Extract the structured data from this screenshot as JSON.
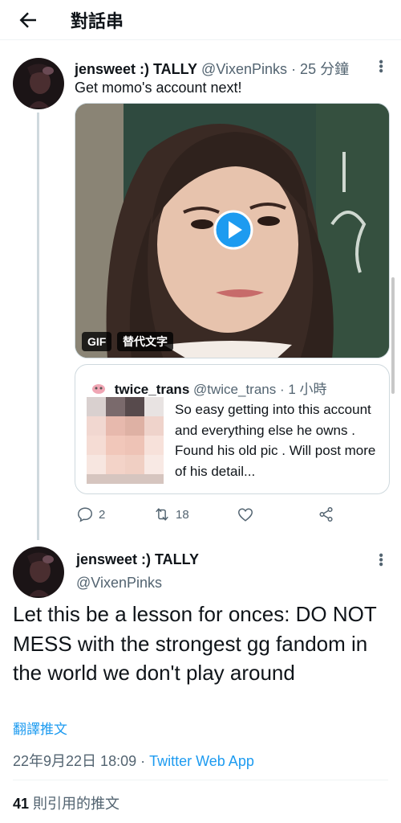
{
  "header": {
    "title": "對話串"
  },
  "tweet1": {
    "display_name": "jensweet :) TALLY",
    "handle": "@VixenPinks",
    "time": "· 25 分鐘",
    "text": "Get momo's account next!",
    "media": {
      "badge_gif": "GIF",
      "badge_alt": "替代文字"
    },
    "quote": {
      "display_name": "twice_trans",
      "handle": "@twice_trans",
      "time": "· 1 小時",
      "text": "So easy getting into this account and everything else he owns . Found his old pic . Will post more of his detail..."
    },
    "actions": {
      "replies": "2",
      "retweets": "18"
    }
  },
  "tweet2": {
    "display_name": "jensweet :) TALLY",
    "handle": "@VixenPinks",
    "text": "Let this be a lesson for onces: DO NOT MESS with the strongest gg fandom in the world we don't play around",
    "translate_label": "翻譯推文",
    "timestamp": "22年9月22日 18:09 ·",
    "source": "Twitter Web App",
    "quote_count": "41",
    "quote_label": "則引用的推文"
  },
  "colors": {
    "link": "#1d9bf0",
    "muted": "#536471",
    "text": "#0f1419",
    "border": "#cfd9de"
  },
  "icons": [
    "back-arrow-icon",
    "more-icon",
    "play-icon",
    "reply-icon",
    "retweet-icon",
    "like-icon",
    "share-icon"
  ]
}
